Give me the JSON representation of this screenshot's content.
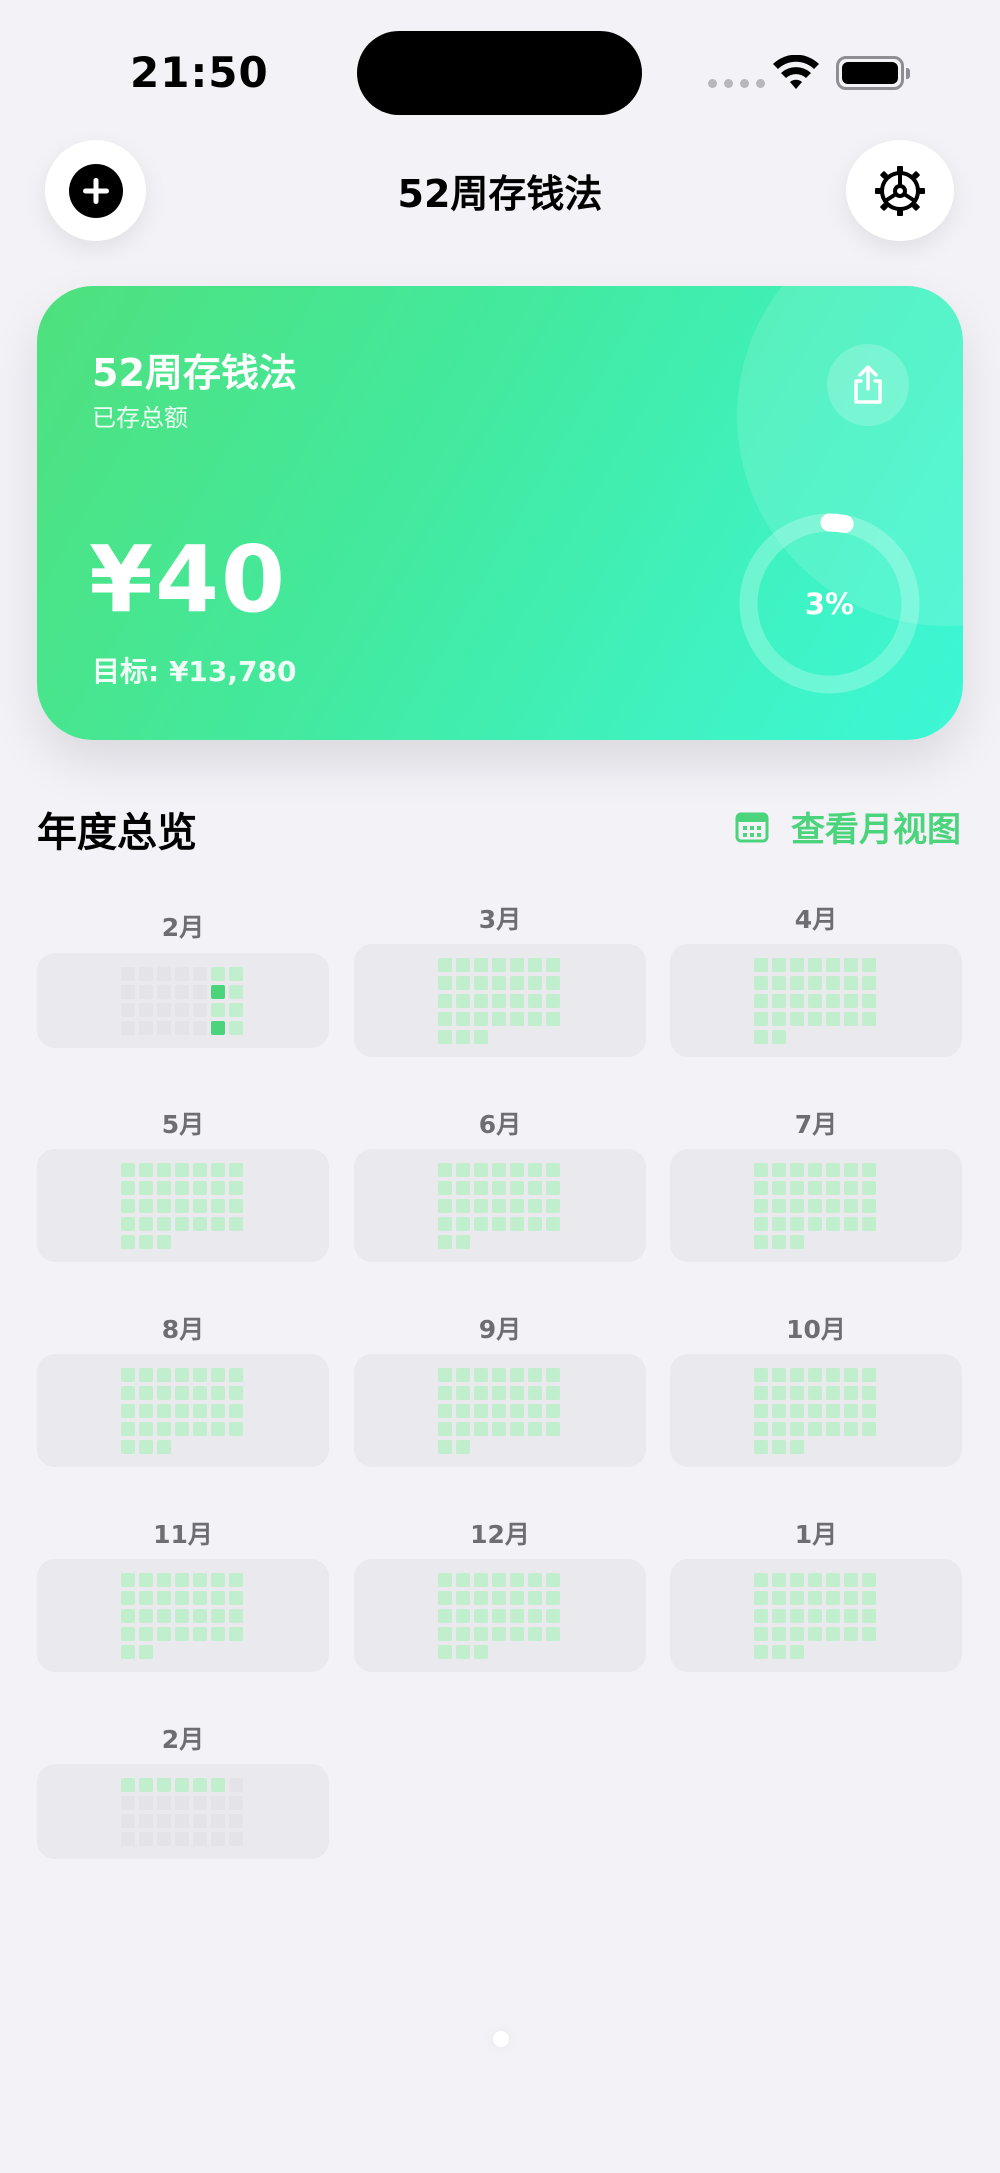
{
  "status": {
    "time": "21:50"
  },
  "nav": {
    "title": "52周存钱法"
  },
  "card": {
    "title": "52周存钱法",
    "subtitle": "已存总额",
    "amount": "¥40",
    "target": "目标: ¥13,780",
    "progress_text": "3%",
    "progress_fraction": 0.03
  },
  "overview": {
    "title": "年度总览",
    "month_view_label": "查看月视图"
  },
  "months": [
    {
      "label": "2月",
      "days": 28,
      "offset": 0,
      "done": [
        12,
        26
      ],
      "type": "current"
    },
    {
      "label": "3月",
      "days": 31,
      "offset": 0,
      "done": [],
      "type": "normal"
    },
    {
      "label": "4月",
      "days": 30,
      "offset": 0,
      "done": [],
      "type": "normal"
    },
    {
      "label": "5月",
      "days": 31,
      "offset": 0,
      "done": [],
      "type": "normal"
    },
    {
      "label": "6月",
      "days": 30,
      "offset": 0,
      "done": [],
      "type": "normal"
    },
    {
      "label": "7月",
      "days": 31,
      "offset": 0,
      "done": [],
      "type": "normal"
    },
    {
      "label": "8月",
      "days": 31,
      "offset": 0,
      "done": [],
      "type": "normal"
    },
    {
      "label": "9月",
      "days": 30,
      "offset": 0,
      "done": [],
      "type": "normal"
    },
    {
      "label": "10月",
      "days": 31,
      "offset": 0,
      "done": [],
      "type": "normal"
    },
    {
      "label": "11月",
      "days": 30,
      "offset": 0,
      "done": [],
      "type": "normal"
    },
    {
      "label": "12月",
      "days": 31,
      "offset": 0,
      "done": [],
      "type": "normal"
    },
    {
      "label": "1月",
      "days": 31,
      "offset": 0,
      "done": [],
      "type": "normal"
    },
    {
      "label": "2月",
      "days": 28,
      "offset": 0,
      "done": [],
      "type": "future"
    }
  ],
  "colors": {
    "accent": "#4cd47c",
    "cell_pending": "#c1eecc",
    "cell_empty": "#e3e3e8",
    "card_gradient_start": "#4fe07d",
    "card_gradient_end": "#3cf7d6"
  },
  "icons": {
    "add": "plus-circle-icon",
    "settings": "gear-icon",
    "share": "share-icon",
    "calendar": "calendar-icon"
  }
}
